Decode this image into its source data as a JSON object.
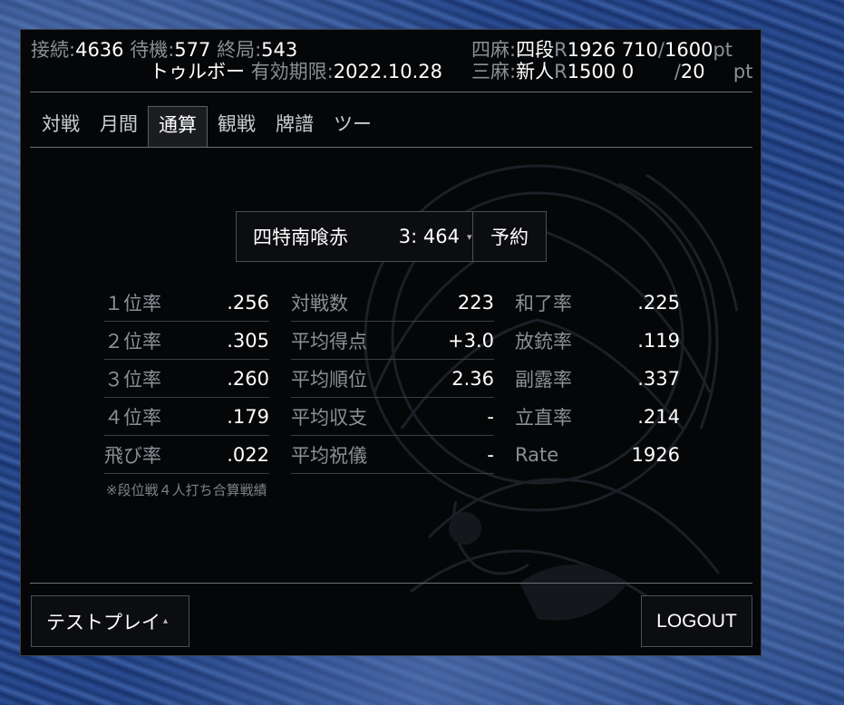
{
  "header": {
    "connect_label": "接続:",
    "connect_value": "4636",
    "wait_label": "待機:",
    "wait_value": "577",
    "end_label": "終局:",
    "end_value": "543",
    "username": "トゥルボー",
    "expiry_label": "有効期限:",
    "expiry_value": "2022.10.28",
    "four_label": "四麻:",
    "four_rank": "四段",
    "four_r": "R",
    "four_rating": "1926",
    "four_points": "710",
    "four_slash": "/",
    "four_max": "1600",
    "four_unit": "pt",
    "three_label": "三麻:",
    "three_rank": "新人",
    "three_r": "R",
    "three_rating": "1500",
    "three_points": "0",
    "three_slash": "/",
    "three_max": "20",
    "three_unit": "pt"
  },
  "tabs": [
    "対戦",
    "月間",
    "通算",
    "観戦",
    "牌譜",
    "ツー"
  ],
  "active_tab": "通算",
  "selector": {
    "mode": "四特南喰赤",
    "count": "3: 464",
    "reserve_label": "予約"
  },
  "stats": {
    "col1": [
      {
        "label": "１位率",
        "value": ".256"
      },
      {
        "label": "２位率",
        "value": ".305"
      },
      {
        "label": "３位率",
        "value": ".260"
      },
      {
        "label": "４位率",
        "value": ".179"
      },
      {
        "label": "飛び率",
        "value": ".022"
      }
    ],
    "col2": [
      {
        "label": "対戦数",
        "value": "223"
      },
      {
        "label": "平均得点",
        "value": "+3.0"
      },
      {
        "label": "平均順位",
        "value": "2.36"
      },
      {
        "label": "平均収支",
        "value": "-"
      },
      {
        "label": "平均祝儀",
        "value": "-"
      }
    ],
    "col3": [
      {
        "label": "和了率",
        "value": ".225"
      },
      {
        "label": "放銃率",
        "value": ".119"
      },
      {
        "label": "副露率",
        "value": ".337"
      },
      {
        "label": "立直率",
        "value": ".214"
      },
      {
        "label": "Rate",
        "value": "1926"
      }
    ]
  },
  "note": "※段位戦４人打ち合算戦績",
  "footer": {
    "testplay_label": "テストプレイ",
    "logout_label": "LOGOUT"
  },
  "colors": {
    "panel_bg": "#050608",
    "label_gray": "#8b8f96",
    "text_white": "#ffffff",
    "separator": "#6b6f76"
  },
  "icons": {
    "dropdown_caret": "caret-down-icon",
    "dropup_caret": "caret-up-icon",
    "background_emblem": "phoenix-emblem"
  }
}
